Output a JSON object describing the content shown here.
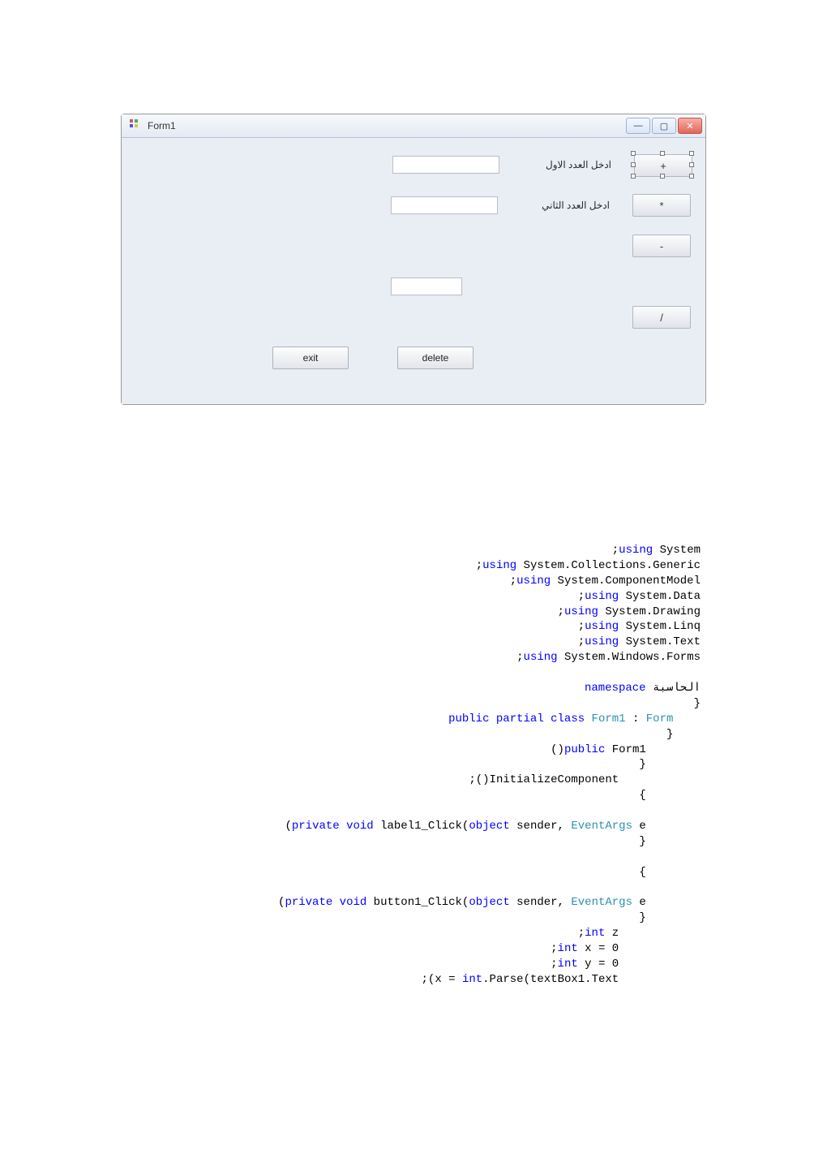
{
  "window": {
    "title": "Form1",
    "labels": {
      "first": "ادخل العدد الاول",
      "second": "ادخل العدد الثاني"
    },
    "buttons": {
      "plus": "+",
      "mul": "*",
      "minus": "-",
      "div": "/",
      "exit": "exit",
      "delete": "delete"
    },
    "winbtns": {
      "min": "—",
      "max": "▢",
      "close": "✕"
    }
  },
  "code": {
    "l1": ";using System",
    "l2": ";using System.Collections.Generic",
    "l3": ";using System.ComponentModel",
    "l4": ";using System.Data",
    "l5": ";using System.Drawing",
    "l6": ";using System.Linq",
    "l7": ";using System.Text",
    "l8": ";using System.Windows.Forms",
    "l9": "الحاسبة namespace",
    "l10": "}",
    "l11": "public partial class Form1 : Form",
    "l12": "}",
    "l13": "()public Form1",
    "l14": "}",
    "l15": ";()InitializeComponent",
    "l16": "{",
    "l17": "(private void label1_Click(object sender, EventArgs e",
    "l18": "}",
    "l19": "{",
    "l20": "(private void button1_Click(object sender, EventArgs e",
    "l21": "}",
    "l22": ";int z",
    "l23": ";int x = 0",
    "l24": ";int y = 0",
    "l25": ";(x = int.Parse(textBox1.Text"
  }
}
